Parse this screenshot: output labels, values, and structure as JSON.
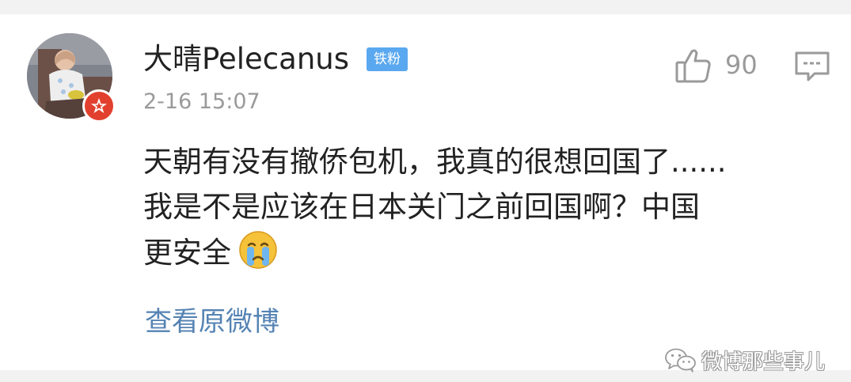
{
  "comment": {
    "username": "大晴Pelecanus",
    "fan_badge": "铁粉",
    "time": "2-16 15:07",
    "like_count": "90",
    "content_lines": [
      "天朝有没有撤侨包机，我真的很想回国了......",
      "我是不是应该在日本关门之前回国啊？中国",
      "更安全"
    ],
    "emoji": "crying-face",
    "view_original": "查看原微博"
  },
  "watermark": {
    "text": "微博那些事儿",
    "icon": "wechat-icon"
  },
  "colors": {
    "background": "#f2f2f2",
    "card": "#ffffff",
    "fan_badge": "#5aa8ef",
    "link": "#5583b3",
    "vip_badge": "#e2402f",
    "muted_text": "#9a9a9a"
  }
}
